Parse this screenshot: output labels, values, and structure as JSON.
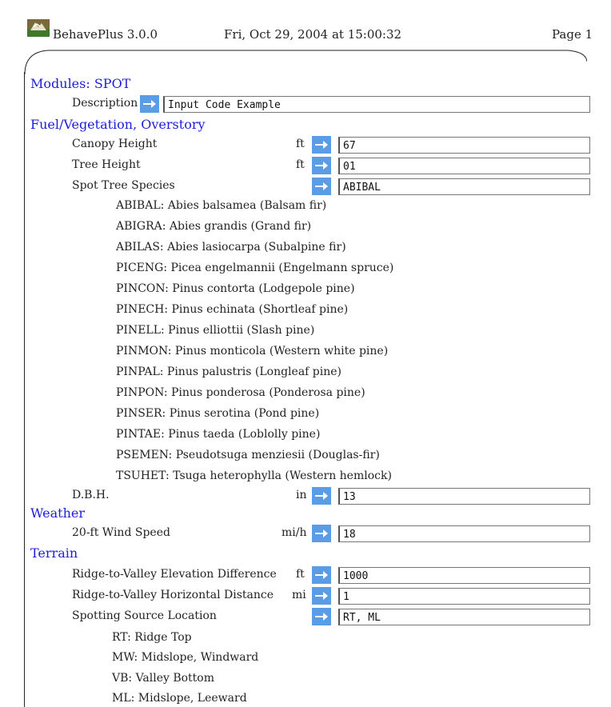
{
  "header": {
    "app": "BehavePlus 3.0.0",
    "date": "Fri, Oct 29, 2004 at 15:00:32",
    "page": "Page 1"
  },
  "modules": {
    "title": "Modules: SPOT",
    "description_label": "Description",
    "description_value": "Input Code Example"
  },
  "fuel": {
    "title": "Fuel/Vegetation, Overstory",
    "canopy_label": "Canopy Height",
    "canopy_unit": "ft",
    "canopy_value": "67",
    "tree_label": "Tree Height",
    "tree_unit": "ft",
    "tree_value": "01",
    "species_label": "Spot Tree Species",
    "species_value": "ABIBAL",
    "species_options": [
      "ABIBAL: Abies balsamea (Balsam fir)",
      "ABIGRA: Abies grandis (Grand fir)",
      "ABILAS: Abies lasiocarpa (Subalpine fir)",
      "PICENG: Picea engelmannii (Engelmann spruce)",
      "PINCON: Pinus contorta (Lodgepole pine)",
      "PINECH: Pinus echinata (Shortleaf pine)",
      "PINELL: Pinus elliottii (Slash pine)",
      "PINMON: Pinus monticola (Western white pine)",
      "PINPAL: Pinus palustris (Longleaf pine)",
      "PINPON: Pinus ponderosa (Ponderosa pine)",
      "PINSER: Pinus serotina (Pond pine)",
      "PINTAE: Pinus taeda (Loblolly pine)",
      "PSEMEN: Pseudotsuga menziesii (Douglas-fir)",
      "TSUHET: Tsuga heterophylla (Western hemlock)"
    ],
    "dbh_label": "D.B.H.",
    "dbh_unit": "in",
    "dbh_value": "13"
  },
  "weather": {
    "title": "Weather",
    "wind_label": "20-ft Wind Speed",
    "wind_unit": "mi/h",
    "wind_value": "18"
  },
  "terrain": {
    "title": "Terrain",
    "elev_label": "Ridge-to-Valley Elevation Difference",
    "elev_unit": "ft",
    "elev_value": "1000",
    "horiz_label": "Ridge-to-Valley Horizontal Distance",
    "horiz_unit": "mi",
    "horiz_value": "1",
    "loc_label": "Spotting Source Location",
    "loc_value": "RT, ML",
    "loc_options": [
      "RT: Ridge Top",
      "MW: Midslope, Windward",
      "VB: Valley Bottom",
      "ML: Midslope, Leeward"
    ]
  },
  "colors": {
    "section": "#1d1ddb",
    "button": "#5a9ce6"
  }
}
